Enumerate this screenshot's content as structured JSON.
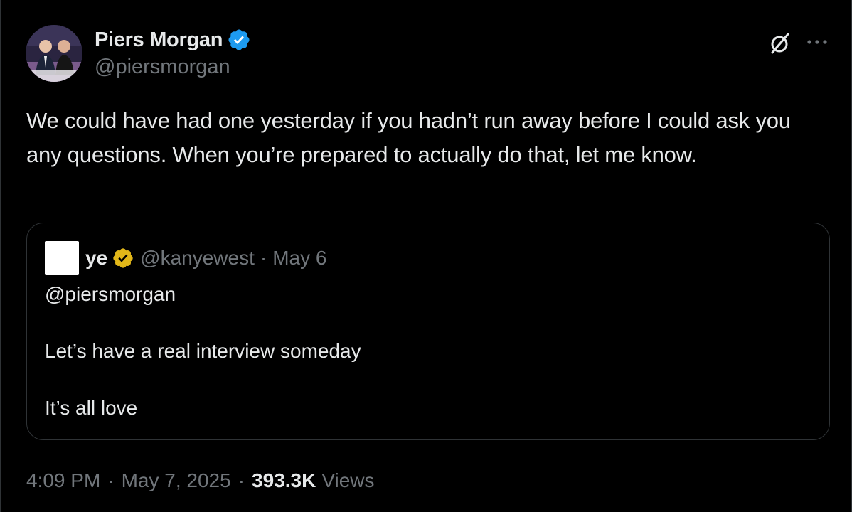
{
  "author": {
    "display_name": "Piers Morgan",
    "handle": "@piersmorgan",
    "verified_color": "#1d9bf0"
  },
  "actions": {
    "grok_icon": "grok-icon",
    "more_icon": "more-icon"
  },
  "tweet": {
    "text": "We could have had one yesterday if you hadn’t run away before I could ask you any questions. When you’re prepared to actually do that, let me know."
  },
  "quote": {
    "display_name": "ye",
    "handle": "@kanyewest",
    "separator": "·",
    "date": "May 6",
    "verified_color": "#e2b719",
    "lines": [
      "@piersmorgan",
      "",
      "Let’s have a real interview someday",
      "",
      "It’s all love"
    ]
  },
  "meta": {
    "time": "4:09 PM",
    "separator": "·",
    "date": "May 7, 2025",
    "views_count": "393.3K",
    "views_label": "Views"
  }
}
